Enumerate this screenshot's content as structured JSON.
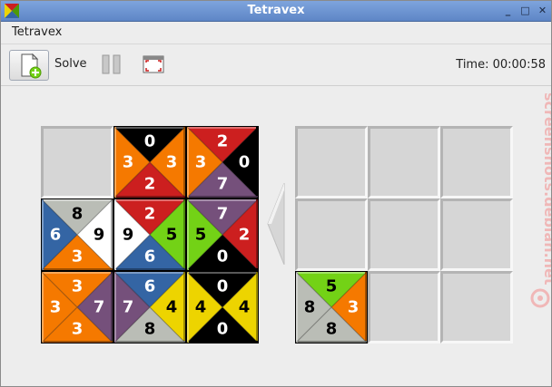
{
  "window": {
    "title": "Tetravex"
  },
  "menubar": {
    "items": [
      "Tetravex"
    ]
  },
  "toolbar": {
    "solve_label": "Solve",
    "time_label": "Time: 00:00:58"
  },
  "colors": {
    "0": "#000000",
    "2": "#cc1f1f",
    "3": "#f57900",
    "4": "#edd400",
    "5": "#73d216",
    "6": "#3465a4",
    "7": "#75507b",
    "8": "#babdb6",
    "9": "#ffffff"
  },
  "left_board": {
    "cells": [
      null,
      {
        "n": 0,
        "e": 3,
        "s": 2,
        "w": 3
      },
      {
        "n": 2,
        "e": 0,
        "s": 7,
        "w": 3
      },
      {
        "n": 8,
        "e": 9,
        "s": 3,
        "w": 6
      },
      {
        "n": 2,
        "e": 5,
        "s": 6,
        "w": 9
      },
      {
        "n": 7,
        "e": 2,
        "s": 0,
        "w": 5
      },
      {
        "n": 3,
        "e": 7,
        "s": 3,
        "w": 3
      },
      {
        "n": 6,
        "e": 4,
        "s": 8,
        "w": 7
      },
      {
        "n": 0,
        "e": 4,
        "s": 0,
        "w": 4
      }
    ]
  },
  "right_board": {
    "cells": [
      null,
      null,
      null,
      null,
      null,
      null,
      {
        "n": 5,
        "e": 3,
        "s": 8,
        "w": 8
      },
      null,
      null
    ]
  },
  "watermark": {
    "text": "screenshots.debian.net"
  }
}
